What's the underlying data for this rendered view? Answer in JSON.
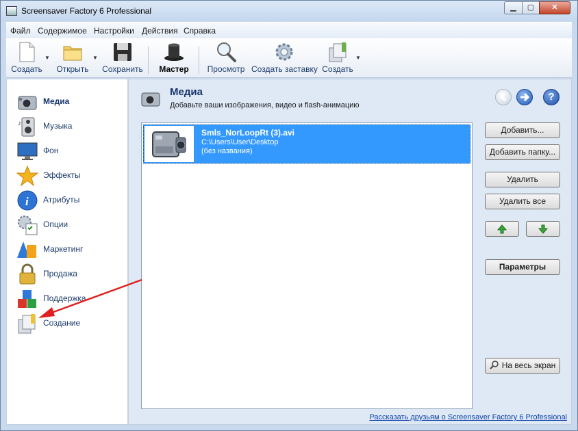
{
  "window": {
    "title": "Screensaver Factory 6 Professional",
    "min": "▁",
    "max": "▢",
    "close": "✕"
  },
  "menu": [
    "Файл",
    "Содержимое",
    "Настройки",
    "Действия",
    "Справка"
  ],
  "toolbar": {
    "create": "Создать",
    "open": "Открыть",
    "save": "Сохранить",
    "wizard": "Мастер",
    "preview": "Просмотр",
    "create_screensaver": "Создать заставку",
    "build": "Создать"
  },
  "nav": [
    {
      "label": "Медиа",
      "icon": "camera-icon",
      "active": true
    },
    {
      "label": "Музыка",
      "icon": "speaker-icon"
    },
    {
      "label": "Фон",
      "icon": "monitor-icon"
    },
    {
      "label": "Эффекты",
      "icon": "star-icon"
    },
    {
      "label": "Атрибуты",
      "icon": "info-icon"
    },
    {
      "label": "Опции",
      "icon": "gear-checklist-icon"
    },
    {
      "label": "Маркетинг",
      "icon": "shapes-icon"
    },
    {
      "label": "Продажа",
      "icon": "padlock-icon"
    },
    {
      "label": "Поддержка",
      "icon": "cubes-icon"
    },
    {
      "label": "Создание",
      "icon": "build-icon"
    }
  ],
  "header": {
    "title": "Медиа",
    "subtitle": "Добавьте ваши изображения, видео и flash-анимацию",
    "help": "?"
  },
  "media_list": [
    {
      "name": "Smls_NorLoopRt (3).avi",
      "path": "C:\\Users\\User\\Desktop",
      "title": "(без названия)",
      "selected": true
    }
  ],
  "buttons": {
    "add": "Добавить...",
    "add_folder": "Добавить папку...",
    "delete": "Удалить",
    "delete_all": "Удалить все",
    "params": "Параметры",
    "fullscreen": "На весь экран"
  },
  "footer": {
    "link": "Рассказать друзьям о Screensaver Factory 6 Professional"
  },
  "colors": {
    "selection": "#3399ff",
    "accent": "#16346c",
    "annotation_arrow": "#e02020"
  }
}
